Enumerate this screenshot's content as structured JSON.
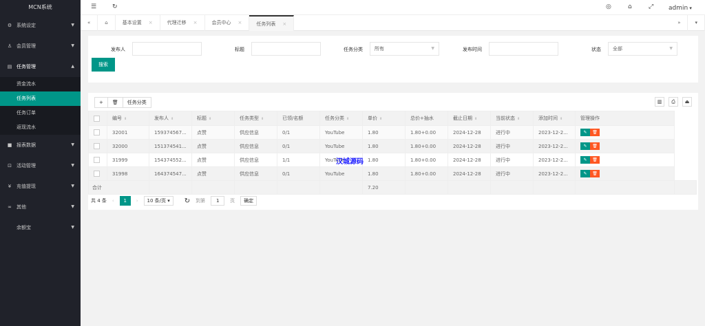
{
  "app": {
    "title": "MCN系统",
    "user": "admin"
  },
  "sidebar": [
    {
      "label": "系统设定",
      "icon": "gear-icon",
      "glyph": "⚙"
    },
    {
      "label": "会员管理",
      "icon": "user-icon",
      "glyph": "♙"
    },
    {
      "label": "任务管理",
      "icon": "doc-icon",
      "glyph": "▤",
      "open": true,
      "children": [
        "资金流水",
        "任务列表",
        "任务订单",
        "返现流水"
      ]
    },
    {
      "label": "报表数据",
      "icon": "chart-icon",
      "glyph": "■"
    },
    {
      "label": "活动管理",
      "icon": "activity-icon",
      "glyph": "⊡"
    },
    {
      "label": "充值提现",
      "icon": "yen-icon",
      "glyph": "¥"
    },
    {
      "label": "其他",
      "icon": "link-icon",
      "glyph": "∞"
    },
    {
      "label": "余额宝",
      "icon": "",
      "glyph": ""
    }
  ],
  "tabs": [
    "基本设置",
    "代理迁移",
    "会员中心",
    "任务列表"
  ],
  "search": {
    "publisher_label": "发布人",
    "title_label": "标题",
    "category_label": "任务分类",
    "category_value": "所有",
    "time_label": "发布时间",
    "status_label": "状态",
    "status_value": "全部",
    "button": "搜索"
  },
  "toolbar": {
    "add": "+",
    "delete": "🗑",
    "category": "任务分类"
  },
  "table": {
    "headers": [
      "编号",
      "发布人",
      "标题",
      "任务类型",
      "已领/名额",
      "任务分类",
      "单价",
      "总价+抽水",
      "截止日期",
      "当前状态",
      "添加时间",
      "管理操作"
    ],
    "rows": [
      [
        "32001",
        "159374567...",
        "点赞",
        "供应信息",
        "0/1",
        "YouTube",
        "1.80",
        "1.80+0.00",
        "2024-12-28",
        "进行中",
        "2023-12-2..."
      ],
      [
        "32000",
        "151374541...",
        "点赞",
        "供应信息",
        "0/1",
        "YouTube",
        "1.80",
        "1.80+0.00",
        "2024-12-28",
        "进行中",
        "2023-12-2..."
      ],
      [
        "31999",
        "154374552...",
        "点赞",
        "供应信息",
        "1/1",
        "YouTube",
        "1.80",
        "1.80+0.00",
        "2024-12-28",
        "进行中",
        "2023-12-2..."
      ],
      [
        "31998",
        "164374547...",
        "点赞",
        "供应信息",
        "0/1",
        "YouTube",
        "1.80",
        "1.80+0.00",
        "2024-12-28",
        "进行中",
        "2023-12-2..."
      ]
    ],
    "total_label": "合计",
    "total_price": "7.20"
  },
  "pagination": {
    "total": "共 4 条",
    "page": "1",
    "per_page": "10 条/页",
    "goto": "到第",
    "goto_value": "1",
    "page_unit": "页",
    "confirm": "确定"
  },
  "watermark": "汉城源码",
  "colors": {
    "accent": "#009688",
    "danger": "#ff5722",
    "sidebar": "#20222a"
  }
}
